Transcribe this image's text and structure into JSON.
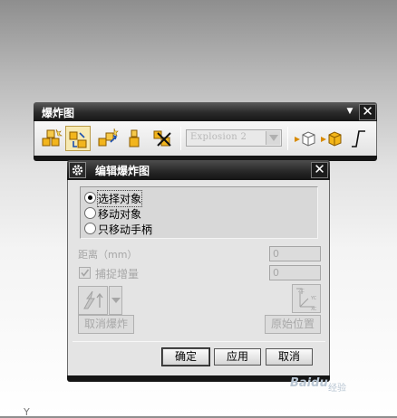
{
  "toolbar": {
    "title": "爆炸图",
    "explosion_select": "Explosion 2",
    "buttons": [
      {
        "name": "new-explosion"
      },
      {
        "name": "edit-explosion"
      },
      {
        "name": "auto-explode"
      },
      {
        "name": "unexplode"
      },
      {
        "name": "delete-explosion"
      },
      {
        "name": "hide-components"
      },
      {
        "name": "show-components"
      },
      {
        "name": "tracelines"
      }
    ]
  },
  "dialog": {
    "title": "编辑爆炸图",
    "radios": [
      {
        "label": "选择对象",
        "selected": true
      },
      {
        "label": "移动对象",
        "selected": false
      },
      {
        "label": "只移动手柄",
        "selected": false
      }
    ],
    "distance_label": "距离（mm）",
    "distance_value": "0",
    "snap_label": "捕捉增量",
    "snap_checked": true,
    "snap_value": "0",
    "unexplode_label": "取消爆炸",
    "original_position_label": "原始位置",
    "ok_label": "确定",
    "apply_label": "应用",
    "cancel_label": "取消"
  },
  "misc": {
    "axis_label": "Y",
    "watermark": "Baidu",
    "watermark_sub": "经验"
  }
}
